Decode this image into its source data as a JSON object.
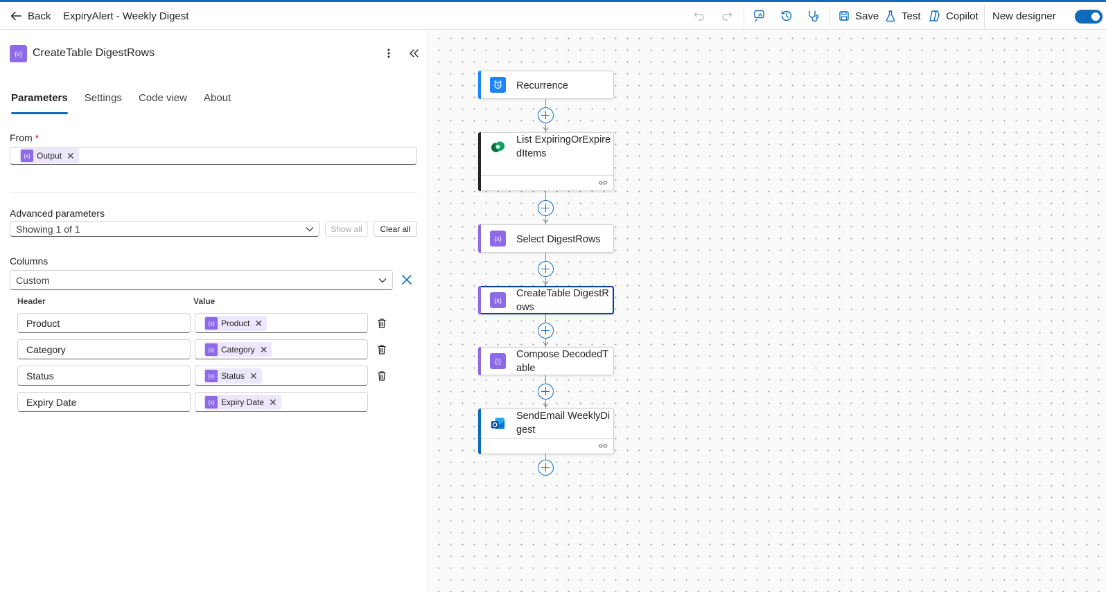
{
  "topbar": {
    "back_label": "Back",
    "flow_title": "ExpiryAlert - Weekly Digest",
    "save_label": "Save",
    "test_label": "Test",
    "copilot_label": "Copilot",
    "new_designer_label": "New designer",
    "new_designer_on": true
  },
  "panel": {
    "action_title": "CreateTable DigestRows",
    "tabs": [
      "Parameters",
      "Settings",
      "Code view",
      "About"
    ],
    "active_tab": "Parameters",
    "from": {
      "label": "From",
      "required_mark": "*",
      "token": "Output"
    },
    "advanced": {
      "label": "Advanced parameters",
      "value": "Showing 1 of 1",
      "show_all": "Show all",
      "clear_all": "Clear all"
    },
    "columns": {
      "label": "Columns",
      "value": "Custom",
      "header_col": "Header",
      "value_col": "Value",
      "rows": [
        {
          "header": "Product",
          "value": "Product"
        },
        {
          "header": "Category",
          "value": "Category"
        },
        {
          "header": "Status",
          "value": "Status"
        },
        {
          "header": "Expiry Date",
          "value": "Expiry Date"
        }
      ]
    }
  },
  "canvas": {
    "cards": [
      {
        "title": "Recurrence",
        "icon": "alarm-clock-icon",
        "accent": "#1f85ff"
      },
      {
        "title": "List ExpiringOrExpiredItems",
        "icon": "dataverse-icon",
        "accent": "#242424"
      },
      {
        "title": "Select DigestRows",
        "icon": "data-operation-icon",
        "accent": "#8d6ae8"
      },
      {
        "title": "CreateTable DigestRows",
        "icon": "data-operation-icon",
        "accent": "#8d6ae8"
      },
      {
        "title": "Compose DecodedTable",
        "icon": "data-operation-icon",
        "accent": "#8d6ae8"
      },
      {
        "title": "SendEmail WeeklyDigest",
        "icon": "outlook-icon",
        "accent": "#0f6cbd"
      }
    ]
  },
  "colors": {
    "brand": "#0f6cbd",
    "token_purple": "#8d6ae8",
    "token_bg": "#ece7fb"
  }
}
